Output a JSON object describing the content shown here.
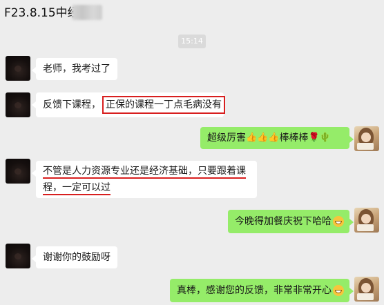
{
  "header": {
    "title": "F23.8.15中经"
  },
  "chat": {
    "timestamp": "15:14",
    "messages": [
      {
        "side": "left",
        "text": "老师，我考过了"
      },
      {
        "side": "left",
        "text_prefix": "反馈下课程，",
        "text_highlight": "正保的课程一丁点毛病没有"
      },
      {
        "side": "right",
        "text": "超级厉害",
        "text_suffix": "棒棒棒"
      },
      {
        "side": "left",
        "line1": "不管是人力资源专业还是经济基础，只要跟着课",
        "line2": "程，一定可以过"
      },
      {
        "side": "right",
        "text": "今晚得加餐庆祝下哈哈"
      },
      {
        "side": "left",
        "text": "谢谢你的鼓励呀"
      },
      {
        "side": "right",
        "text": "真棒，感谢您的反馈，非常非常开心"
      }
    ]
  },
  "emoji": {
    "thumb": "👍",
    "rose": "🌹",
    "cactus": "🌵"
  },
  "icons": {
    "thumb": "thumbs-up-icon",
    "rose": "rose-icon",
    "cactus": "cactus-icon",
    "grin": "grin-emoji-icon"
  },
  "colors": {
    "background": "#ededed",
    "left_bubble": "#ffffff",
    "right_bubble": "#95ec69",
    "highlight_red": "#d81e1e"
  }
}
